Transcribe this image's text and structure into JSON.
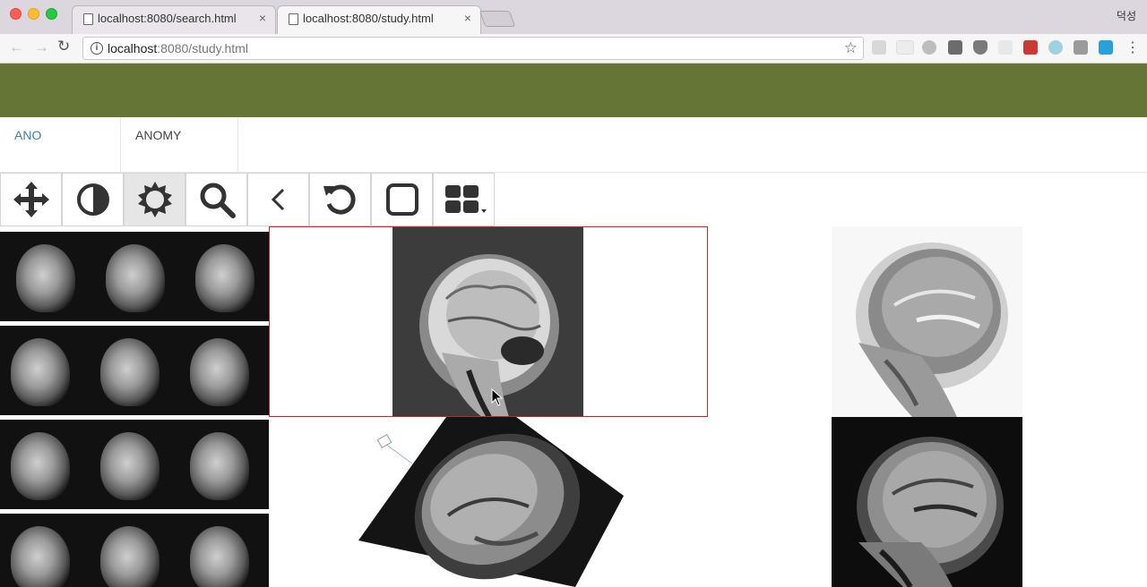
{
  "browser": {
    "tabs": [
      {
        "title": "localhost:8080/search.html",
        "close": "×"
      },
      {
        "title": "localhost:8080/study.html",
        "close": "×"
      }
    ],
    "user_label": "덕성",
    "url_host": "localhost",
    "url_path": ":8080/study.html",
    "info_icon": "i",
    "star_icon": "☆",
    "back_icon": "←",
    "forward_icon": "→",
    "reload_icon": "↻"
  },
  "app": {
    "header_color": "#657535",
    "subnav": [
      {
        "label": "ANO",
        "state": "active"
      },
      {
        "label": "ANOMY",
        "state": "normal"
      }
    ],
    "tools": [
      {
        "name": "pan",
        "icon": "move-icon",
        "active": false
      },
      {
        "name": "window-level",
        "icon": "contrast-icon",
        "active": false
      },
      {
        "name": "brightness",
        "icon": "sun-icon",
        "active": true
      },
      {
        "name": "zoom",
        "icon": "magnifier-icon",
        "active": false
      },
      {
        "name": "previous",
        "icon": "chevron-left-icon",
        "active": false
      },
      {
        "name": "reset",
        "icon": "rotate-icon",
        "active": false
      },
      {
        "name": "roi",
        "icon": "square-icon",
        "active": false
      },
      {
        "name": "layout",
        "icon": "grid-icon",
        "active": false
      }
    ],
    "thumbnails_count": 4,
    "accent_active_viewport": "#c0282e"
  }
}
